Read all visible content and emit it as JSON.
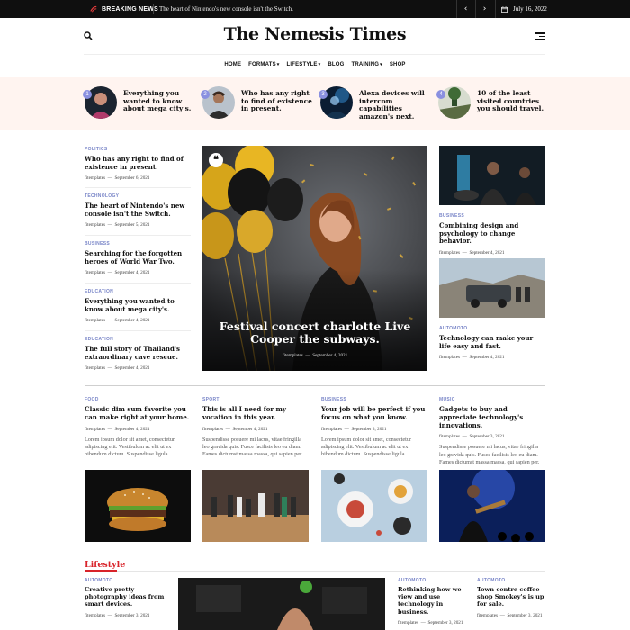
{
  "topbar": {
    "breaking_label": "BREAKING NEWS",
    "ticker_text": "The heart of Nintendo's new console isn't the Switch.",
    "date": "July 16, 2022"
  },
  "masthead": {
    "logo": "The Nemesis Times"
  },
  "nav": {
    "items": [
      {
        "label": "HOME",
        "dropdown": false
      },
      {
        "label": "FORMATS",
        "dropdown": true
      },
      {
        "label": "LIFESTYLE",
        "dropdown": true
      },
      {
        "label": "BLOG",
        "dropdown": false
      },
      {
        "label": "TRAINING",
        "dropdown": true
      },
      {
        "label": "SHOP",
        "dropdown": false
      }
    ]
  },
  "featured": [
    {
      "num": "1",
      "title": "Everything you wanted to know about mega city's."
    },
    {
      "num": "2",
      "title": "Who has any right to find of existence in present."
    },
    {
      "num": "3",
      "title": "Alexa devices will intercom capabilities amazon's next."
    },
    {
      "num": "4",
      "title": "10 of the least visited countries you should travel."
    }
  ],
  "left_column": [
    {
      "category": "POLITICS",
      "title": "Who has any right to find of existence in present.",
      "author": "fitemplates",
      "date": "September 6, 2021"
    },
    {
      "category": "TECHNOLOGY",
      "title": "The heart of Nintendo's new console isn't the Switch.",
      "author": "fitemplates",
      "date": "September 5, 2021"
    },
    {
      "category": "BUSINESS",
      "title": "Searching for the forgotten heroes of World War Two.",
      "author": "fitemplates",
      "date": "September 4, 2021"
    },
    {
      "category": "EDUCATION",
      "title": "Everything you wanted to know about mega city's.",
      "author": "fitemplates",
      "date": "September 4, 2021"
    },
    {
      "category": "EDUCATION",
      "title": "The full story of Thailand's extraordinary cave rescue.",
      "author": "fitemplates",
      "date": "September 4, 2021"
    }
  ],
  "hero": {
    "title": "Festival concert charlotte Live Cooper the subways.",
    "author": "fitemplates",
    "date": "September 4, 2021"
  },
  "right_column": [
    {
      "category": "BUSINESS",
      "title": "Combining design and psychology to change behavior.",
      "author": "fitemplates",
      "date": "September 4, 2021"
    },
    {
      "category": "AUTOMOTO",
      "title": "Technology can make your life easy and fast.",
      "author": "fitemplates",
      "date": "September 4, 2021"
    }
  ],
  "grid": [
    {
      "category": "FOOD",
      "title": "Classic dim sum favorite you can make right at your home.",
      "author": "fitemplates",
      "date": "September 4, 2021",
      "excerpt": "Lorem ipsum dolor sit amet, consectetur adipiscing elit. Vestibulum ac elit ut ex bibendum dictum. Suspendisse ligula"
    },
    {
      "category": "SPORT",
      "title": "This is all I need for my vocation in this year.",
      "author": "fitemplates",
      "date": "September 4, 2021",
      "excerpt": "Suspendisse posuere mi lacus, vitae fringilla leo gravida quis. Fusce facilisis leo eu diam. Fames dictumst massa massa, qui sapien per."
    },
    {
      "category": "BUSINESS",
      "title": "Your job will be perfect if you focus on what you know.",
      "author": "fitemplates",
      "date": "September 3, 2021",
      "excerpt": "Lorem ipsum dolor sit amet, consectetur adipiscing elit. Vestibulum ac elit ut ex bibendum dictum. Suspendisse ligula"
    },
    {
      "category": "MUSIC",
      "title": "Gadgets to buy and appreciate technology's innovations.",
      "author": "fitemplates",
      "date": "September 3, 2021",
      "excerpt": "Suspendisse posuere mi lacus, vitae fringilla leo gravida quis. Fusce facilisis leo eu diam. Fames dictumst massa massa, qui sapien per."
    }
  ],
  "lifestyle": {
    "heading": "Lifestyle",
    "left": {
      "category": "AUTOMOTO",
      "title": "Creative pretty photography ideas from smart devices.",
      "author": "fitemplates",
      "date": "September 3, 2021"
    },
    "mid": {
      "category": "AUTOMOTO",
      "title": "Rethinking how we view and use technology in business.",
      "author": "fitemplates",
      "date": "September 3, 2021"
    },
    "right": {
      "category": "AUTOMOTO",
      "title": "Town centre coffee shop Smokey's is up for sale.",
      "author": "fitemplates",
      "date": "September 3, 2021"
    }
  },
  "colors": {
    "accent": "#d8232a",
    "category": "#7a86c8",
    "strip_bg": "#fff4f0",
    "topbar_bg": "#0f0f0f"
  },
  "icons": [
    "flash-icon",
    "search-icon",
    "menu-icon",
    "chevron-left-icon",
    "chevron-right-icon",
    "calendar-icon",
    "quote-icon"
  ]
}
